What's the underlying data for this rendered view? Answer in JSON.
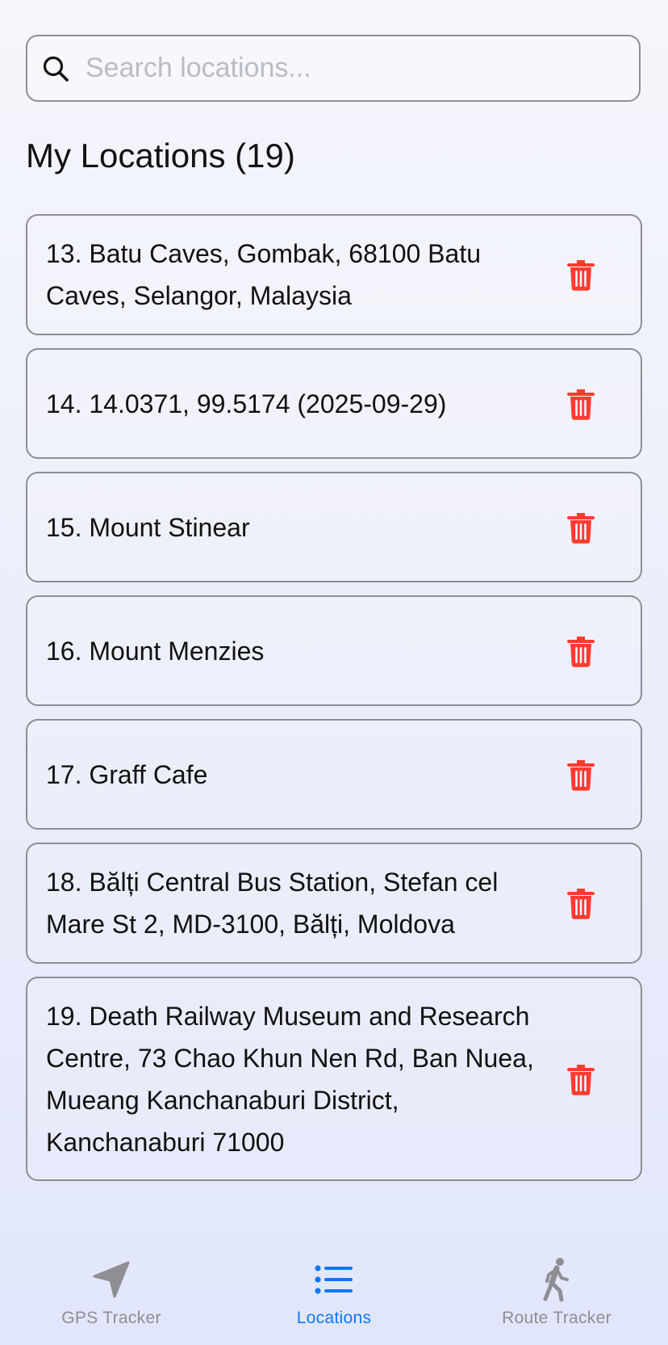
{
  "search": {
    "placeholder": "Search locations...",
    "value": ""
  },
  "page_title": "My Locations (19)",
  "locations": [
    {
      "text": "13. Batu Caves, Gombak, 68100 Batu Caves, Selangor, Malaysia"
    },
    {
      "text": "14. 14.0371, 99.5174 (2025-09-29)"
    },
    {
      "text": "15. Mount Stinear"
    },
    {
      "text": "16. Mount Menzies"
    },
    {
      "text": "17. Graff Cafe"
    },
    {
      "text": "18. Bălți Central Bus Station, Stefan cel Mare St 2, MD-3100, Bălți, Moldova"
    },
    {
      "text": "19. Death Railway Museum and Research Centre, 73 Chao Khun Nen Rd, Ban Nuea, Mueang Kanchanaburi District, Kanchanaburi 71000"
    }
  ],
  "tabs": [
    {
      "label": "GPS Tracker",
      "icon": "location-arrow-icon",
      "active": false
    },
    {
      "label": "Locations",
      "icon": "list-icon",
      "active": true
    },
    {
      "label": "Route Tracker",
      "icon": "walking-person-icon",
      "active": false
    }
  ],
  "colors": {
    "accent": "#0a7aff",
    "delete": "#ff3b30",
    "inactive": "#8e8e93"
  },
  "delete_icon": "trash-icon"
}
